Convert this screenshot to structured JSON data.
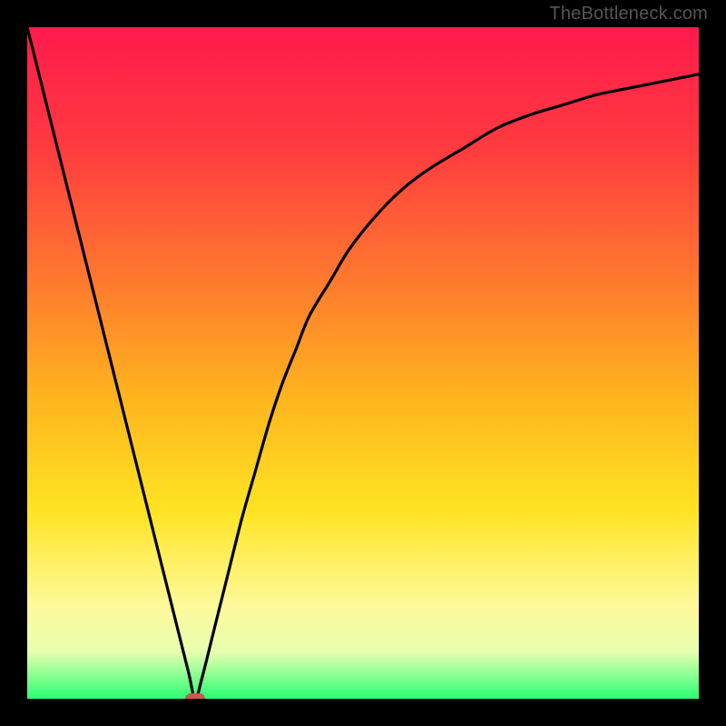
{
  "attribution": "TheBottleneck.com",
  "colors": {
    "frame": "#000000",
    "gradient_stops": [
      {
        "offset": 0.0,
        "color": "#ff1a4d"
      },
      {
        "offset": 0.18,
        "color": "#ff3b3f"
      },
      {
        "offset": 0.38,
        "color": "#ff7a2e"
      },
      {
        "offset": 0.55,
        "color": "#ffb41e"
      },
      {
        "offset": 0.72,
        "color": "#ffe423"
      },
      {
        "offset": 0.86,
        "color": "#fff99a"
      },
      {
        "offset": 0.93,
        "color": "#e8ffb0"
      },
      {
        "offset": 1.0,
        "color": "#2bff74"
      }
    ],
    "curve_stroke": "#000000",
    "marker_fill": "#c9594f"
  },
  "chart_data": {
    "type": "line",
    "title": "",
    "xlabel": "",
    "ylabel": "",
    "xlim": [
      0,
      100
    ],
    "ylim": [
      0,
      100
    ],
    "grid": false,
    "x": [
      0,
      2,
      4,
      6,
      8,
      10,
      12,
      14,
      16,
      18,
      20,
      22,
      24,
      25,
      26,
      28,
      30,
      32,
      34,
      36,
      38,
      40,
      42,
      45,
      48,
      52,
      56,
      60,
      65,
      70,
      75,
      80,
      85,
      90,
      95,
      100
    ],
    "values": [
      100,
      92,
      84,
      76,
      68,
      60,
      52,
      44,
      36,
      28,
      20,
      12,
      4,
      0,
      3,
      11,
      19,
      27,
      34,
      41,
      47,
      52,
      57,
      62,
      67,
      72,
      76,
      79,
      82,
      85,
      87,
      88.5,
      90,
      91,
      92,
      93
    ],
    "marker": {
      "x": 25,
      "y": 0
    }
  }
}
